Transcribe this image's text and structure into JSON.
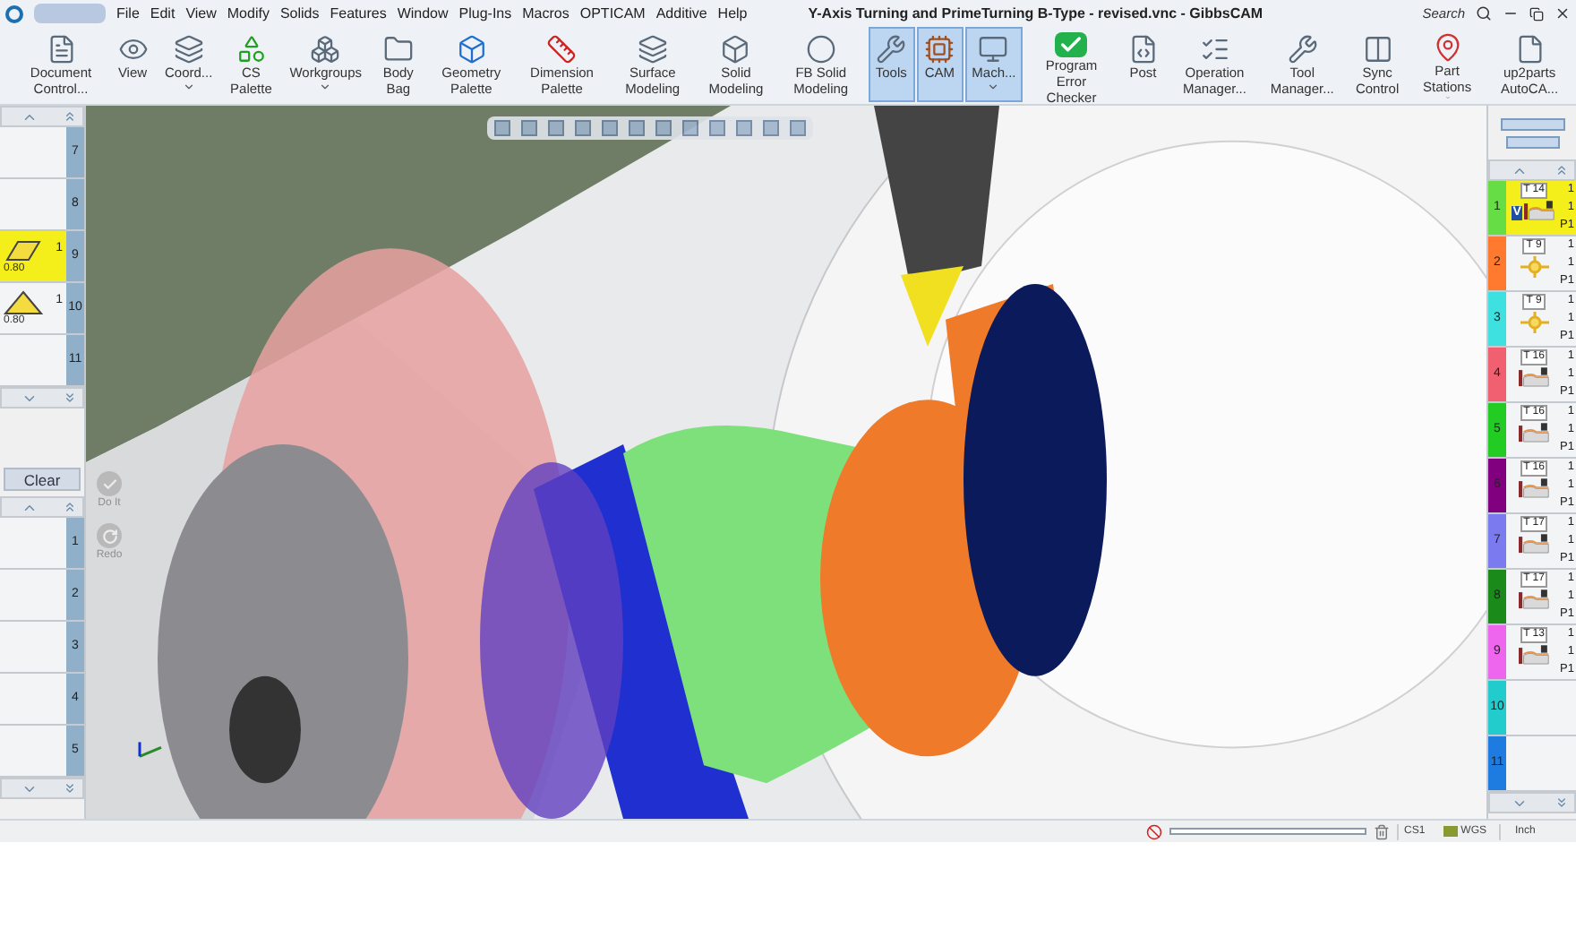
{
  "window": {
    "title": "Y-Axis Turning and PrimeTurning B-Type - revised.vnc - GibbsCAM",
    "search": "Search"
  },
  "menu": [
    "File",
    "Edit",
    "View",
    "Modify",
    "Solids",
    "Features",
    "Window",
    "Plug-Ins",
    "Macros",
    "OPTICAM",
    "Additive",
    "Help"
  ],
  "ribbon": [
    {
      "label": "Document Control...",
      "selected": false,
      "dropdown": false
    },
    {
      "label": "View",
      "selected": false,
      "dropdown": false
    },
    {
      "label": "Coord...",
      "selected": false,
      "dropdown": true
    },
    {
      "label": "CS Palette",
      "selected": false,
      "dropdown": false
    },
    {
      "label": "Workgroups",
      "selected": false,
      "dropdown": true
    },
    {
      "label": "Body Bag",
      "selected": false,
      "dropdown": false
    },
    {
      "label": "Geometry Palette",
      "selected": false,
      "dropdown": false
    },
    {
      "label": "Dimension Palette",
      "selected": false,
      "dropdown": false
    },
    {
      "label": "Surface Modeling",
      "selected": false,
      "dropdown": false
    },
    {
      "label": "Solid Modeling",
      "selected": false,
      "dropdown": false
    },
    {
      "label": "FB Solid Modeling",
      "selected": false,
      "dropdown": false
    },
    {
      "label": "Tools",
      "selected": true,
      "dropdown": false
    },
    {
      "label": "CAM",
      "selected": true,
      "dropdown": false
    },
    {
      "label": "Mach...",
      "selected": true,
      "dropdown": true
    },
    {
      "label": "Program Error Checker",
      "selected": false,
      "dropdown": false
    },
    {
      "label": "Post",
      "selected": false,
      "dropdown": false
    },
    {
      "label": "Operation Manager...",
      "selected": false,
      "dropdown": false
    },
    {
      "label": "Tool Manager...",
      "selected": false,
      "dropdown": false
    },
    {
      "label": "Sync Control",
      "selected": false,
      "dropdown": false
    },
    {
      "label": "Part Stations",
      "selected": false,
      "dropdown": true
    },
    {
      "label": "up2parts AutoCA...",
      "selected": false,
      "dropdown": false
    }
  ],
  "tool_list": [
    {
      "number": "7",
      "selected": false
    },
    {
      "number": "8",
      "selected": false
    },
    {
      "number": "9",
      "selected": true,
      "kind": "diamond",
      "count": "1",
      "value": "0.80"
    },
    {
      "number": "10",
      "selected": false,
      "kind": "triangle",
      "count": "1",
      "value": "0.80"
    },
    {
      "number": "11",
      "selected": false
    }
  ],
  "clear_button": "Clear",
  "actions": [
    {
      "label": "Do It",
      "disabled": true
    },
    {
      "label": "Redo",
      "disabled": true
    }
  ],
  "process_list": [
    "1",
    "2",
    "3",
    "4",
    "5"
  ],
  "operations": [
    {
      "number": "1",
      "color": "#66dd44",
      "selected": true,
      "kind": "contour",
      "tool": "T 14",
      "counts": [
        "1",
        "1"
      ],
      "part": "P1",
      "badge": "V"
    },
    {
      "number": "2",
      "color": "#ff7a2e",
      "selected": false,
      "kind": "drill",
      "tool": "T 9",
      "counts": [
        "1",
        "1"
      ],
      "part": "P1"
    },
    {
      "number": "3",
      "color": "#3fe0e0",
      "selected": false,
      "kind": "drill",
      "tool": "T 9",
      "counts": [
        "1",
        "1"
      ],
      "part": "P1"
    },
    {
      "number": "4",
      "color": "#f06070",
      "selected": false,
      "kind": "contour",
      "tool": "T 16",
      "counts": [
        "1",
        "1"
      ],
      "part": "P1"
    },
    {
      "number": "5",
      "color": "#22cc22",
      "selected": false,
      "kind": "contour",
      "tool": "T 16",
      "counts": [
        "1",
        "1"
      ],
      "part": "P1"
    },
    {
      "number": "6",
      "color": "#800080",
      "selected": false,
      "kind": "contour",
      "tool": "T 16",
      "counts": [
        "1",
        "1"
      ],
      "part": "P1"
    },
    {
      "number": "7",
      "color": "#7b7bef",
      "selected": false,
      "kind": "contour",
      "tool": "T 17",
      "counts": [
        "1",
        "1"
      ],
      "part": "P1"
    },
    {
      "number": "8",
      "color": "#1a8a1a",
      "selected": false,
      "kind": "contour",
      "tool": "T 17",
      "counts": [
        "1",
        "1"
      ],
      "part": "P1"
    },
    {
      "number": "9",
      "color": "#ee66ee",
      "selected": false,
      "kind": "contour",
      "tool": "T 13",
      "counts": [
        "1",
        "1"
      ],
      "part": "P1"
    },
    {
      "number": "10",
      "color": "#22cccc",
      "selected": false
    },
    {
      "number": "11",
      "color": "#1e7be0",
      "selected": false
    }
  ],
  "status_bar": {
    "coordinate_system": "CS1",
    "space": "WGS",
    "units": "Inch"
  }
}
